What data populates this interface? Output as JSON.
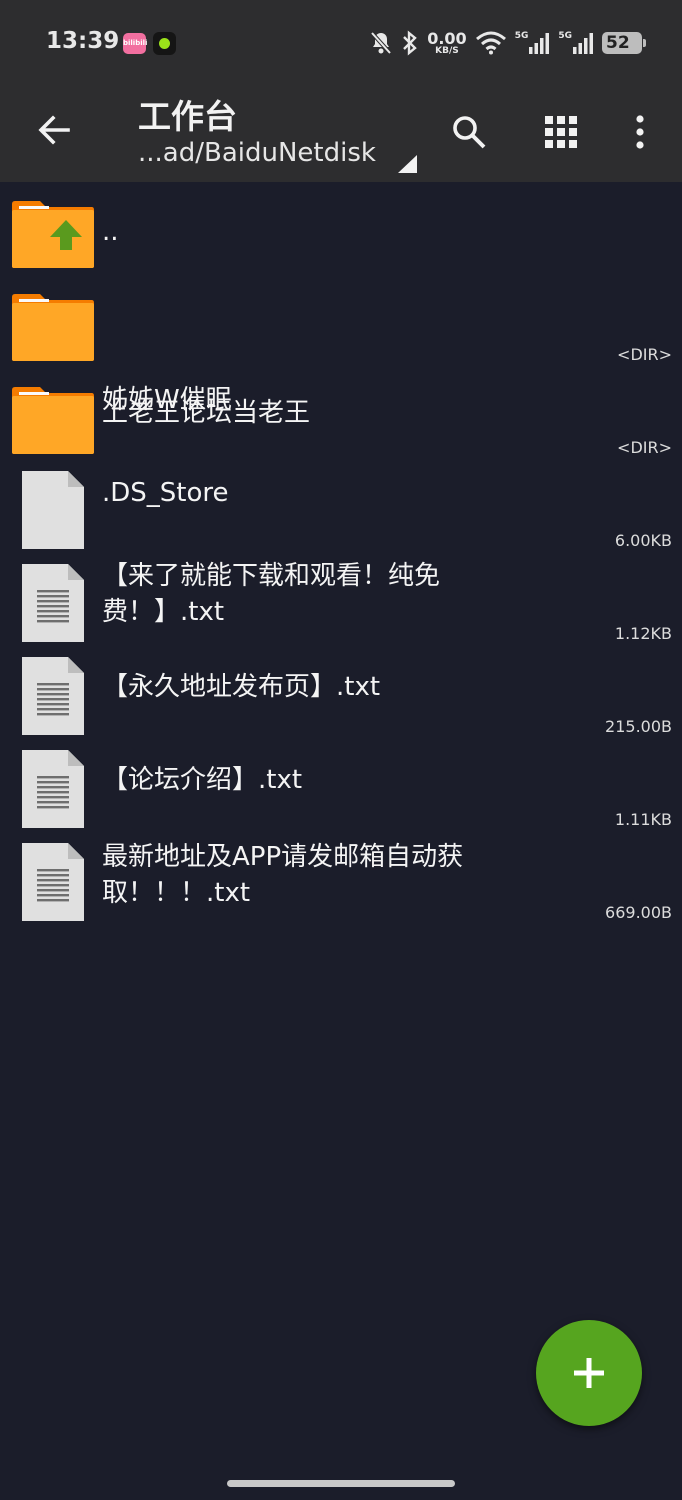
{
  "status_bar": {
    "time": "13:39",
    "bili_badge": "bilibili",
    "net_speed_value": "0.00",
    "net_speed_unit": "KB/S",
    "signal1_label": "5G",
    "signal2_label": "5G",
    "battery": "52"
  },
  "toolbar": {
    "title": "工作台",
    "path": "...ad/BaiduNetdisk"
  },
  "files": [
    {
      "name": "..",
      "meta": "",
      "type": "parent-folder"
    },
    {
      "name": "上老王论坛当老王",
      "meta": "<DIR>",
      "type": "folder"
    },
    {
      "name": "姊姊W催眠",
      "meta": "<DIR>",
      "type": "folder"
    },
    {
      "name": ".DS_Store",
      "meta": "6.00KB",
      "type": "file"
    },
    {
      "name": "【来了就能下载和观看！纯免费！】.txt",
      "meta": "1.12KB",
      "type": "text-file"
    },
    {
      "name": "【永久地址发布页】.txt",
      "meta": "215.00B",
      "type": "text-file"
    },
    {
      "name": "【论坛介绍】.txt",
      "meta": "1.11KB",
      "type": "text-file"
    },
    {
      "name": "最新地址及APP请发邮箱自动获取！！！.txt",
      "meta": "669.00B",
      "type": "text-file"
    }
  ],
  "colors": {
    "background": "#1b1d2a",
    "toolbar": "#2d2d2f",
    "folder": "#ffa726",
    "fab": "#56a51f"
  }
}
